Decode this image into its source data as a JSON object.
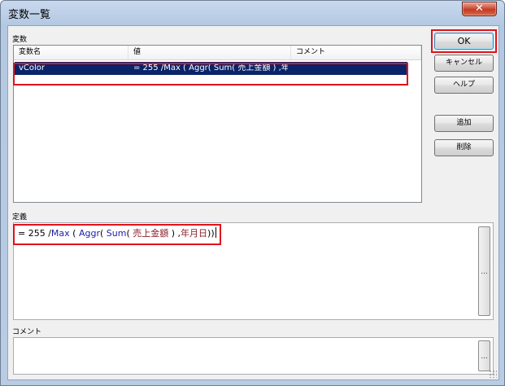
{
  "window": {
    "title": "変数一覧",
    "close_glyph": "✕"
  },
  "variables": {
    "group_label": "変数",
    "columns": [
      "変数名",
      "値",
      "コメント"
    ],
    "rows": [
      {
        "name": "vColor",
        "value": "= 255 /Max ( Aggr( Sum( 売上金額 ) ,年月日",
        "comment": ""
      }
    ]
  },
  "buttons": {
    "ok": "OK",
    "cancel": "キャンセル",
    "help": "ヘルプ",
    "add": "追加",
    "delete": "削除"
  },
  "definition": {
    "label": "定義",
    "parts": {
      "p1": "= 255 /",
      "kw_max": "Max",
      "p2": " ( ",
      "kw_aggr": "Aggr",
      "p3": "( ",
      "kw_sum": "Sum",
      "p4": "( ",
      "field": "売上金額",
      "p5": " ) ,",
      "dim": "年月日",
      "p6": "))"
    },
    "expand_button": "..."
  },
  "comment": {
    "label": "コメント",
    "expand_button": "..."
  }
}
